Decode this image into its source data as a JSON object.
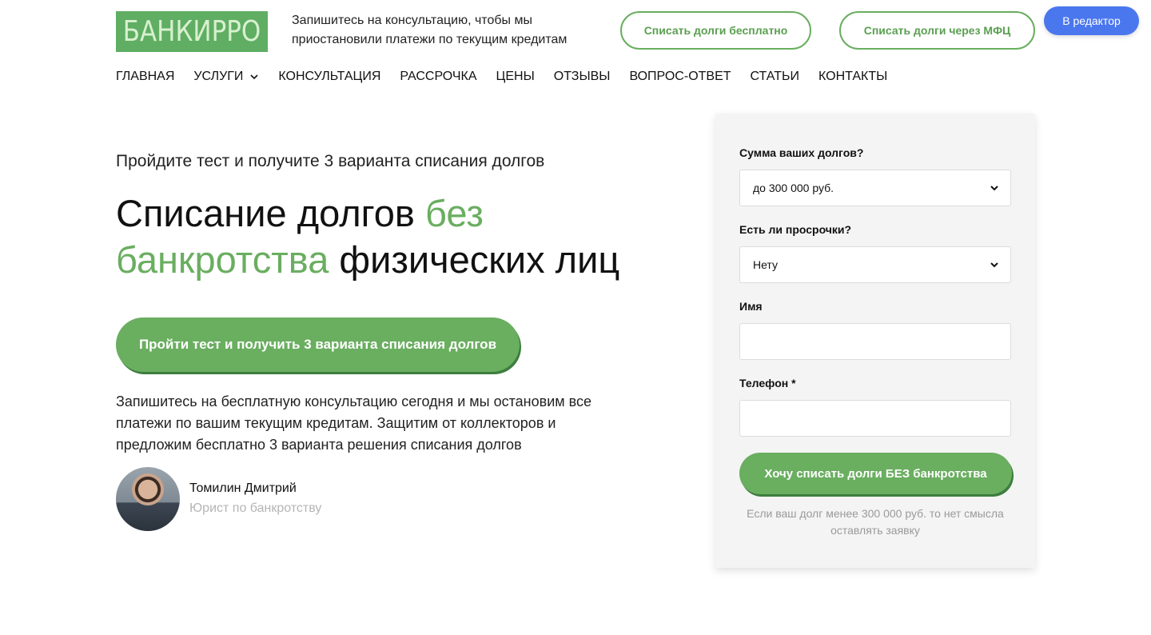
{
  "header": {
    "logo_text": "БАНКИРРО",
    "tagline": "Запишитесь на консультацию, чтобы мы приостановили платежи по текущим кредитам",
    "btn_free": "Списать долги бесплатно",
    "btn_mfc": "Списать долги через МФЦ",
    "btn_editor": "В редактор"
  },
  "nav": {
    "items": [
      "ГЛАВНАЯ",
      "УСЛУГИ",
      "КОНСУЛЬТАЦИЯ",
      "РАССРОЧКА",
      "ЦЕНЫ",
      "ОТЗЫВЫ",
      "ВОПРОС-ОТВЕТ",
      "СТАТЬИ",
      "КОНТАКТЫ"
    ]
  },
  "hero": {
    "subtitle": "Пройдите тест и получите 3 варианта списания долгов",
    "title_part1": "Списание долгов ",
    "title_accent": "без банкротства",
    "title_part2": " физических лиц",
    "cta": "Пройти тест и получить 3 варианта списания долгов",
    "description": "Запишитесь на бесплатную консультацию сегодня и мы остановим все платежи по вашим текущим кредитам. Защитим от коллекторов и предложим бесплатно 3 варианта решения списания долгов",
    "person_name": "Томилин Дмитрий",
    "person_role": "Юрист по банкротству"
  },
  "form": {
    "debt_label": "Сумма ваших долгов?",
    "debt_value": "до 300 000 руб.",
    "overdue_label": "Есть ли просрочки?",
    "overdue_value": "Нету",
    "name_label": "Имя",
    "name_value": "",
    "phone_label": "Телефон *",
    "phone_value": "",
    "submit": "Хочу списать долги БЕЗ банкротства",
    "note": "Если ваш долг менее 300 000 руб. то нет смысла оставлять заявку"
  },
  "colors": {
    "accent": "#6aae60",
    "editor_button": "#4a77ee"
  }
}
